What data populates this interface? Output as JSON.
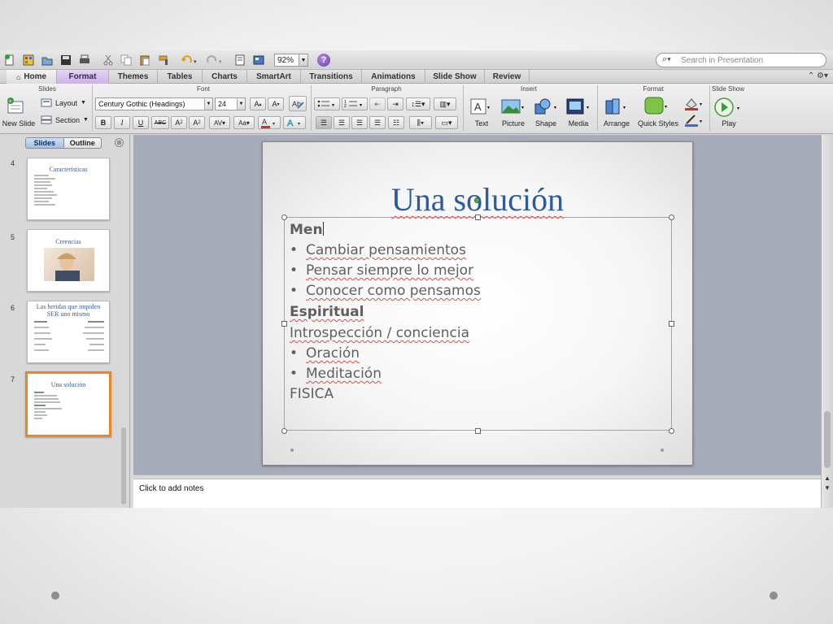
{
  "toolbar": {
    "zoom": "92%",
    "help_label": "?",
    "search_placeholder": "Search in Presentation",
    "search_icon_glyph": "⌕▾"
  },
  "ribbon_tabs": [
    "Home",
    "Format",
    "Themes",
    "Tables",
    "Charts",
    "SmartArt",
    "Transitions",
    "Animations",
    "Slide Show",
    "Review"
  ],
  "ribbon_right_icons": "⌃ ⚙▾",
  "ribbon": {
    "groups": {
      "slides": "Slides",
      "font": "Font",
      "paragraph": "Paragraph",
      "insert": "Insert",
      "format": "Format",
      "slide_show": "Slide Show"
    },
    "new_slide": "New Slide",
    "layout": "Layout",
    "section": "Section",
    "font_name": "Century Gothic (Headings)",
    "font_size": "24",
    "insert_buttons": [
      "Text",
      "Picture",
      "Shape",
      "Media"
    ],
    "format_buttons": [
      "Arrange",
      "Quick Styles"
    ],
    "play": "Play"
  },
  "left_pane": {
    "tabs": [
      "Slides",
      "Outline"
    ],
    "close_icon": "⊗",
    "slides": [
      {
        "num": "4",
        "title": "Caracteristicas"
      },
      {
        "num": "5",
        "title": "Creencias"
      },
      {
        "num": "6",
        "title": "Las heridas que impiden SER uno mismo"
      },
      {
        "num": "7",
        "title": "Una solución"
      }
    ]
  },
  "slide": {
    "title": "Una solución",
    "lines": [
      {
        "text": "Men",
        "style": "bold",
        "bullet": false
      },
      {
        "text": "Cambiar pensamientos",
        "style": "normal",
        "bullet": true
      },
      {
        "text": "Pensar siempre lo mejor",
        "style": "normal",
        "bullet": true
      },
      {
        "text": "Conocer como pensamos",
        "style": "normal",
        "bullet": true
      },
      {
        "text": "Espiritual",
        "style": "bold",
        "bullet": false
      },
      {
        "text": "Introspección / conciencia",
        "style": "normal",
        "bullet": false
      },
      {
        "text": "Oración",
        "style": "normal",
        "bullet": true
      },
      {
        "text": "Meditación",
        "style": "normal",
        "bullet": true
      },
      {
        "text": "FISICA",
        "style": "normal",
        "bullet": false
      }
    ]
  },
  "notes_placeholder": "Click to add notes",
  "colors": {
    "active_tab": "#c9b3e3",
    "title_blue": "#2c5a9e",
    "selected_thumb_border": "#e8862b"
  }
}
